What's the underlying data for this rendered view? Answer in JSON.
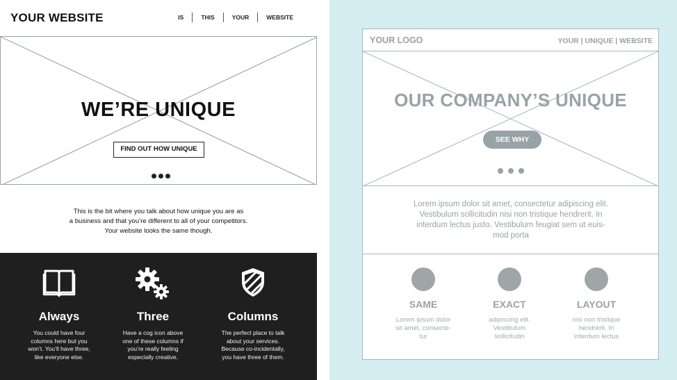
{
  "left": {
    "brand": "YOUR WEBSITE",
    "nav": [
      "IS",
      "THIS",
      "YOUR",
      "WEBSITE"
    ],
    "hero": {
      "title": "WE’RE UNIQUE",
      "button": "FIND OUT HOW UNIQUE"
    },
    "intro": [
      "This is the bit where you talk about how unique you are as",
      "a business and that you’re different to all of your competitors.",
      "Your website looks the same though."
    ],
    "columns": [
      {
        "icon": "book-icon",
        "title": "Always",
        "text": [
          "You could have four",
          "columns here but you",
          "won’t. You’ll have three,",
          "like everyone else."
        ]
      },
      {
        "icon": "gears-icon",
        "title": "Three",
        "text": [
          "Have a cog icon above",
          "one of these columns if",
          "you’re really feeling",
          "especially creative."
        ]
      },
      {
        "icon": "shield-icon",
        "title": "Columns",
        "text": [
          "The perfect place to talk",
          "about your services.",
          "Because co-incidentally,",
          "you have three of them."
        ]
      }
    ]
  },
  "right": {
    "logo": "YOUR LOGO",
    "nav": [
      "YOUR",
      "UNIQUE",
      "WEBSITE"
    ],
    "nav_separator": " | ",
    "hero": {
      "title": "OUR COMPANY’S UNIQUE",
      "button": "SEE WHY"
    },
    "lorem": [
      "Lorem ipsum dolor sit amet, consectetur adipiscing elit.",
      "Vestibulum sollicitudin nisi non tristique hendrerit. In",
      "interdum lectus justo. Vestibulum feugiat sem ut euis-",
      "mod porta"
    ],
    "columns": [
      {
        "title": "SAME",
        "text": [
          "Lorem ipsum dolor",
          "sit amet, consecte-",
          "tur"
        ]
      },
      {
        "title": "EXACT",
        "text": [
          "adipiscing elit.",
          "Vestibulum",
          "sollicitudin"
        ]
      },
      {
        "title": "LAYOUT",
        "text": [
          "nisi non tristique",
          "hendrerit. In",
          "interdum lectus"
        ]
      }
    ]
  },
  "colors": {
    "dark_band": "#1f1f1f",
    "right_background": "#d4eef1",
    "muted_gray": "#97a3a6"
  }
}
